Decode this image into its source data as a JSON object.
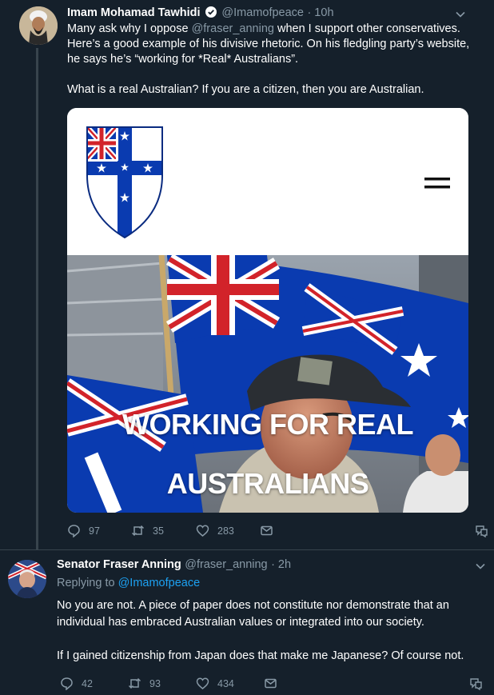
{
  "tweet1": {
    "name": "Imam Mohamad Tawhidi",
    "handle": "@Imamofpeace",
    "time": "· 10h",
    "line1_pre": "Many ask why I oppose ",
    "line1_mention": "@fraser_anning",
    "line1_post": " when I support other conservatives.",
    "line2": "Here’s a good example of his divisive rhetoric. On his fledgling party’s website,",
    "line3": "he says he’s “working for *Real* Australians”.",
    "line4": "What is a real Australian? If you are a citizen, then you are Australian.",
    "card": {
      "banner_line1": "WORKING FOR REAL",
      "banner_line2": "AUSTRALIANS"
    },
    "actions": {
      "replies": "97",
      "retweets": "35",
      "likes": "283"
    }
  },
  "tweet2": {
    "name": "Senator Fraser Anning",
    "handle": "@fraser_anning",
    "time": "· 2h",
    "replying_prefix": "Replying to ",
    "replying_to": "@Imamofpeace",
    "line1": "No you are not. A piece of paper does not constitute nor demonstrate that an",
    "line2": "individual has embraced Australian values or integrated into our society.",
    "line3": "If I gained citizenship from Japan does that make me Japanese? Of course not.",
    "actions": {
      "replies": "42",
      "retweets": "93",
      "likes": "434"
    }
  },
  "colors": {
    "background": "#15202b",
    "muted": "#8899a6",
    "link": "#1da1f2",
    "flag_blue": "#0a3bb0",
    "flag_red": "#d2232a"
  }
}
